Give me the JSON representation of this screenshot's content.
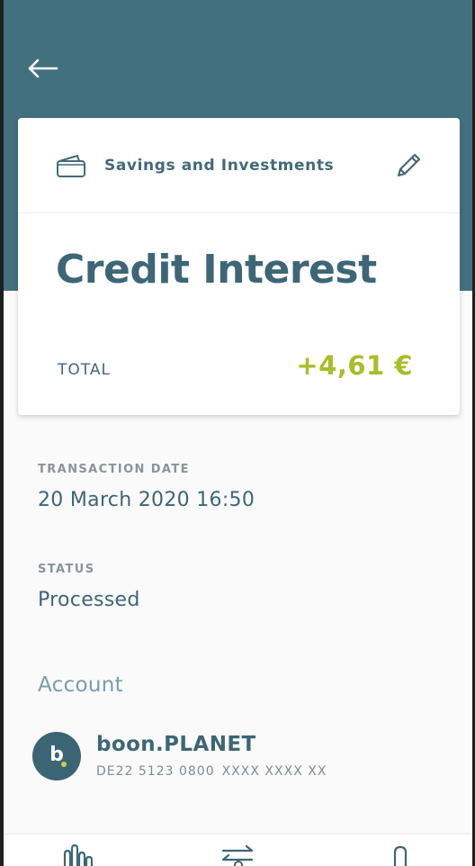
{
  "header": {
    "back_icon": "arrow-left-icon",
    "background_color": "#43707f"
  },
  "card": {
    "category_icon": "wallet-icon",
    "category_label": "Savings and Investments",
    "edit_icon": "pencil-icon",
    "title": "Credit Interest",
    "total_label": "TOTAL",
    "total_amount": "+4,61 €",
    "amount_color": "#a9bd2a"
  },
  "details": {
    "transaction_date_label": "TRANSACTION DATE",
    "transaction_date_value": "20 March 2020 16:50",
    "status_label": "STATUS",
    "status_value": "Processed"
  },
  "account": {
    "section_title": "Account",
    "avatar_text": "b",
    "name": "boon.PLANET",
    "iban_prefix": "DE22 5123 0800",
    "iban_mask": "XXXX XXXX XX"
  },
  "bottom_nav": {
    "items": [
      {
        "icon": "bar-chart-icon"
      },
      {
        "icon": "transfer-icon"
      },
      {
        "icon": "location-pin-icon"
      }
    ]
  }
}
